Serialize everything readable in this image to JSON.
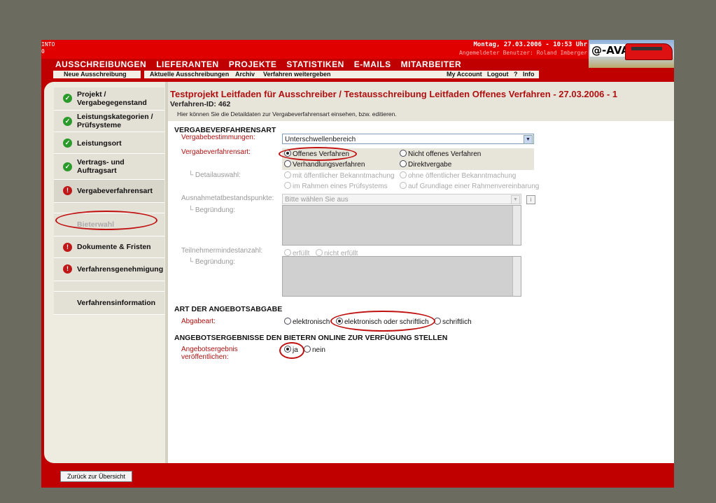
{
  "header": {
    "corner_text": [
      "INTO",
      "0"
    ],
    "datetime": "Montag, 27.03.2006 - 10:53 Uhr",
    "user": "Angemeldeter Benutzer: Roland Imberger",
    "logo": "@-AVA"
  },
  "mainnav": [
    "AUSSCHREIBUNGEN",
    "LIEFERANTEN",
    "PROJEKTE",
    "STATISTIKEN",
    "E-MAILS",
    "MITARBEITER"
  ],
  "subnav": {
    "new": "Neue Ausschreibung",
    "current": "Aktuelle Ausschreibungen",
    "archive": "Archiv",
    "forward": "Verfahren weitergeben",
    "account": "My Account",
    "logout": "Logout",
    "help": "?",
    "info": "Info"
  },
  "sidebar": {
    "items": [
      {
        "label": "Projekt /\nVergabegegenstand",
        "status": "ok"
      },
      {
        "label": "Leistungskategorien /\nPrüfsysteme",
        "status": "ok"
      },
      {
        "label": "Leistungsort",
        "status": "ok"
      },
      {
        "label": "Vertrags- und\nAuftragsart",
        "status": "ok"
      },
      {
        "label": "Vergabeverfahrensart",
        "status": "error"
      },
      {
        "label": "",
        "status": "none"
      },
      {
        "label": "Bieterwahl",
        "status": "disabled"
      },
      {
        "label": "Dokumente & Fristen",
        "status": "error"
      },
      {
        "label": "Verfahrensgenehmigung",
        "status": "error"
      },
      {
        "label": "",
        "status": "none"
      },
      {
        "label": "Verfahrensinformation",
        "status": "none"
      }
    ]
  },
  "main": {
    "title": "Testprojekt Leitfaden für Ausschreiber / Testausschreibung Leitfaden Offenes Verfahren - 27.03.2006 - 1",
    "verfahren_id": "Verfahren-ID: 462",
    "hint": "Hier können Sie die Detaildaten zur Vergabeverfahrensart einsehen, bzw. editieren.",
    "section1": {
      "heading": "VERGABEVERFAHRENSART",
      "bestimmungen_label": "Vergabebestimmungen:",
      "bestimmungen_value": "Unterschwellenbereich",
      "verfahrensart_label": "Vergabeverfahrensart:",
      "options": [
        "Offenes Verfahren",
        "Nicht offenes Verfahren",
        "Verhandlungsverfahren",
        "Direktvergabe"
      ],
      "selected": "Offenes Verfahren",
      "detail_label": "Detailauswahl:",
      "detail_options": [
        "mit öffentlicher Bekanntmachung",
        "ohne öffentlicher Bekanntmachung",
        "im Rahmen eines Prüfsystems",
        "auf Grundlage einer Rahmenvereinbarung"
      ],
      "ausnahme_label": "Ausnahmetatbestandspunkte:",
      "ausnahme_placeholder": "Bitte wählen Sie aus",
      "info_icon": "i",
      "begruendung_label": "Begründung:",
      "teilnehmer_label": "Teilnehmermindestanzahl:",
      "teilnehmer_options": [
        "erfüllt",
        "nicht erfüllt"
      ],
      "begruendung2_label": "Begründung:"
    },
    "section2": {
      "heading": "ART DER ANGEBOTSABGABE",
      "label": "Abgabeart:",
      "options": [
        "elektronisch",
        "elektronisch oder schriftlich",
        "schriftlich"
      ],
      "selected": "elektronisch oder schriftlich"
    },
    "section3": {
      "heading": "ANGEBOTSERGEBNISSE DEN BIETERN ONLINE ZUR VERFÜGUNG STELLEN",
      "label_line1": "Angebotsergebnis",
      "label_line2": "veröffentlichen:",
      "options": [
        "ja",
        "nein"
      ],
      "selected": "ja"
    }
  },
  "footer": {
    "back_button": "Zurück zur Übersicht"
  },
  "colors": {
    "brand_red": "#c00000",
    "header_red": "#e00000",
    "title_red": "#b01010",
    "ok_green": "#2a9a2a",
    "error_red": "#c01818"
  }
}
